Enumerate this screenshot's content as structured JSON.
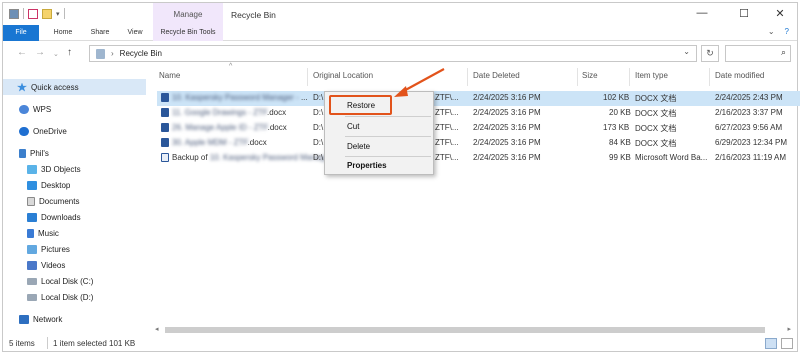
{
  "titlebar": {
    "title": "Recycle Bin",
    "manage_tab": "Manage",
    "minimize": "—",
    "maximize": "☐",
    "close": "✕"
  },
  "ribbon": {
    "tabs": [
      "File",
      "Home",
      "Share",
      "View",
      "Recycle Bin Tools"
    ],
    "expand": "⌄",
    "help": "?"
  },
  "address": {
    "back": "←",
    "forward": "→",
    "recent": "⌄",
    "up": "↑",
    "path": "Recycle Bin",
    "chevron": "›",
    "dropdown": "⌄",
    "refresh": "↻",
    "search_placeholder": "",
    "search_icon": "⌕"
  },
  "nav": {
    "items": [
      {
        "label": "Quick access",
        "icon": "star-icon"
      },
      {
        "label": "WPS",
        "icon": "cloud-icon"
      },
      {
        "label": "OneDrive",
        "icon": "onedrive-icon"
      },
      {
        "label": "Phil's",
        "icon": "user-icon"
      },
      {
        "label": "3D Objects",
        "icon": "cube-icon"
      },
      {
        "label": "Desktop",
        "icon": "desktop-icon"
      },
      {
        "label": "Documents",
        "icon": "documents-icon"
      },
      {
        "label": "Downloads",
        "icon": "downloads-icon"
      },
      {
        "label": "Music",
        "icon": "music-icon"
      },
      {
        "label": "Pictures",
        "icon": "pictures-icon"
      },
      {
        "label": "Videos",
        "icon": "videos-icon"
      },
      {
        "label": "Local Disk (C:)",
        "icon": "disk-icon"
      },
      {
        "label": "Local Disk (D:)",
        "icon": "disk-icon"
      },
      {
        "label": "Network",
        "icon": "network-icon"
      }
    ]
  },
  "list": {
    "columns": [
      "Name",
      "Original Location",
      "Date Deleted",
      "Size",
      "Item type",
      "Date modified"
    ],
    "rows": [
      {
        "name_blur": "10. Kaspersky Password Manager -",
        "name_tail": " ...",
        "loc": "D:\\",
        "loc2": "ZTF\\...",
        "deleted": "2/24/2025 3:16 PM",
        "size": "102 KB",
        "type": "DOCX 文档",
        "modified": "2/24/2025 2:43 PM"
      },
      {
        "name_blur": "11. Google Drawings - ZTF",
        "name_tail": ".docx",
        "loc": "D:\\",
        "loc2": "ZTF\\...",
        "deleted": "2/24/2025 3:16 PM",
        "size": "20 KB",
        "type": "DOCX 文档",
        "modified": "2/16/2023 3:37 PM"
      },
      {
        "name_blur": "26. Manage Apple ID - ZTF",
        "name_tail": ".docx",
        "loc": "D:\\",
        "loc2": "ZTF\\...",
        "deleted": "2/24/2025 3:16 PM",
        "size": "173 KB",
        "type": "DOCX 文档",
        "modified": "6/27/2023 9:56 AM"
      },
      {
        "name_blur": "30. Apple MDM - ZTF",
        "name_tail": ".docx",
        "loc": "D:\\",
        "loc2": "ZTF\\...",
        "deleted": "2/24/2025 3:16 PM",
        "size": "84 KB",
        "type": "DOCX 文档",
        "modified": "6/29/2023 12:34 PM"
      },
      {
        "name_prefix": "Backup of ",
        "name_blur": "10. Kaspersky Password Manager",
        "name_tail": " ...",
        "loc": "D:\\",
        "loc2": "ZTF\\...",
        "deleted": "2/24/2025 3:16 PM",
        "size": "99 KB",
        "type": "Microsoft Word Ba...",
        "modified": "2/16/2023 11:19 AM"
      }
    ]
  },
  "context_menu": {
    "items": [
      "Restore",
      "Cut",
      "Delete",
      "Properties"
    ]
  },
  "status": {
    "items": "5 items",
    "selected": "1 item selected  101 KB"
  },
  "colors": {
    "accent": "#1976d2",
    "highlight": "#e2531b",
    "selection": "#cce4f7",
    "ribbon_context": "#f1e7fb"
  }
}
